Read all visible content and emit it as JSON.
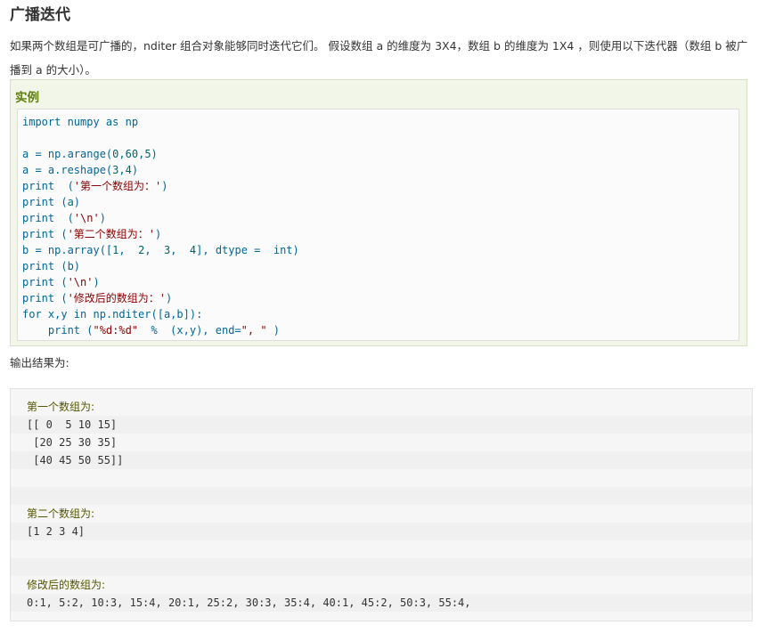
{
  "title": "广播迭代",
  "intro": "如果两个数组是可广播的，nditer 组合对象能够同时迭代它们。 假设数组 a 的维度为 3X4，数组 b 的维度为 1X4 ，则使用以下迭代器（数组 b 被广播到 a 的大小）。",
  "example": {
    "label": "实例",
    "code": [
      "import numpy as np",
      "",
      "a = np.arange(0,60,5)",
      "a = a.reshape(3,4)",
      "print  ('第一个数组为：')",
      "print (a)",
      "print  ('\\n')",
      "print ('第二个数组为：')",
      "b = np.array([1,  2,  3,  4], dtype =  int)",
      "print (b)",
      "print ('\\n')",
      "print ('修改后的数组为：')",
      "for x,y in np.nditer([a,b]):",
      "    print (\"%d:%d\"  %  (x,y), end=\", \" )"
    ]
  },
  "output_label": "输出结果为:",
  "output": [
    "第一个数组为:",
    "[[ 0  5 10 15]",
    " [20 25 30 35]",
    " [40 45 50 55]]",
    "",
    "",
    "第二个数组为:",
    "[1 2 3 4]",
    "",
    "",
    "修改后的数组为:",
    "0:1, 5:2, 10:3, 15:4, 20:1, 25:2, 30:3, 35:4, 40:1, 45:2, 50:3, 55:4,"
  ]
}
